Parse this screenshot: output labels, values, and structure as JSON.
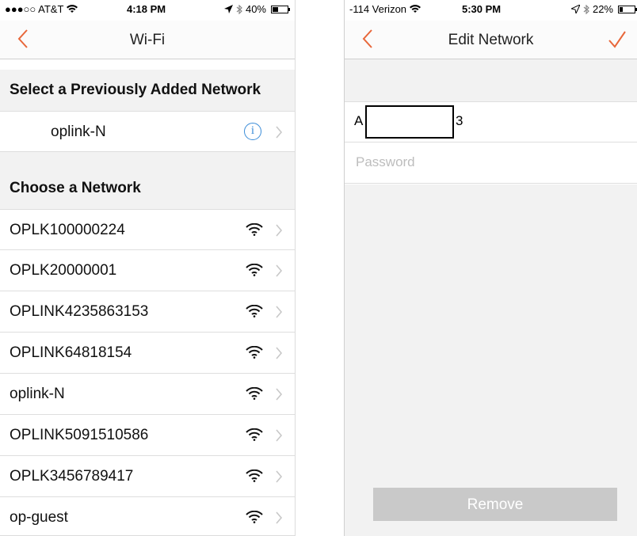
{
  "left": {
    "status": {
      "carrier": "●●●○○ AT&T",
      "time": "4:18 PM",
      "battery_pct": "40%",
      "battery_level": 0.4
    },
    "nav": {
      "title": "Wi-Fi"
    },
    "previous_header": "Select a Previously Added Network",
    "previous_network": "oplink-N",
    "choose_header": "Choose a Network",
    "networks": [
      "OPLK100000224",
      "OPLK20000001",
      "OPLINK4235863153",
      "OPLINK64818154",
      "oplink-N",
      "OPLINK5091510586",
      "OPLK3456789417",
      "op-guest"
    ]
  },
  "right": {
    "status": {
      "carrier": "-114 Verizon",
      "time": "5:30 PM",
      "battery_pct": "22%",
      "battery_level": 0.22
    },
    "nav": {
      "title": "Edit Network"
    },
    "network_field": {
      "value": "A",
      "value_suffix": "3"
    },
    "password_field": {
      "placeholder": "Password"
    },
    "remove_label": "Remove"
  },
  "colors": {
    "accent": "#e8673a",
    "info_blue": "#3a8cd8",
    "chevron": "#c8c8c8",
    "section_bg": "#f2f2f2",
    "button_bg": "#c9c9c9"
  },
  "icons": [
    "back-chevron-icon",
    "checkmark-icon",
    "wifi-icon",
    "info-icon",
    "chevron-right-icon",
    "location-icon",
    "bluetooth-icon",
    "battery-icon"
  ]
}
